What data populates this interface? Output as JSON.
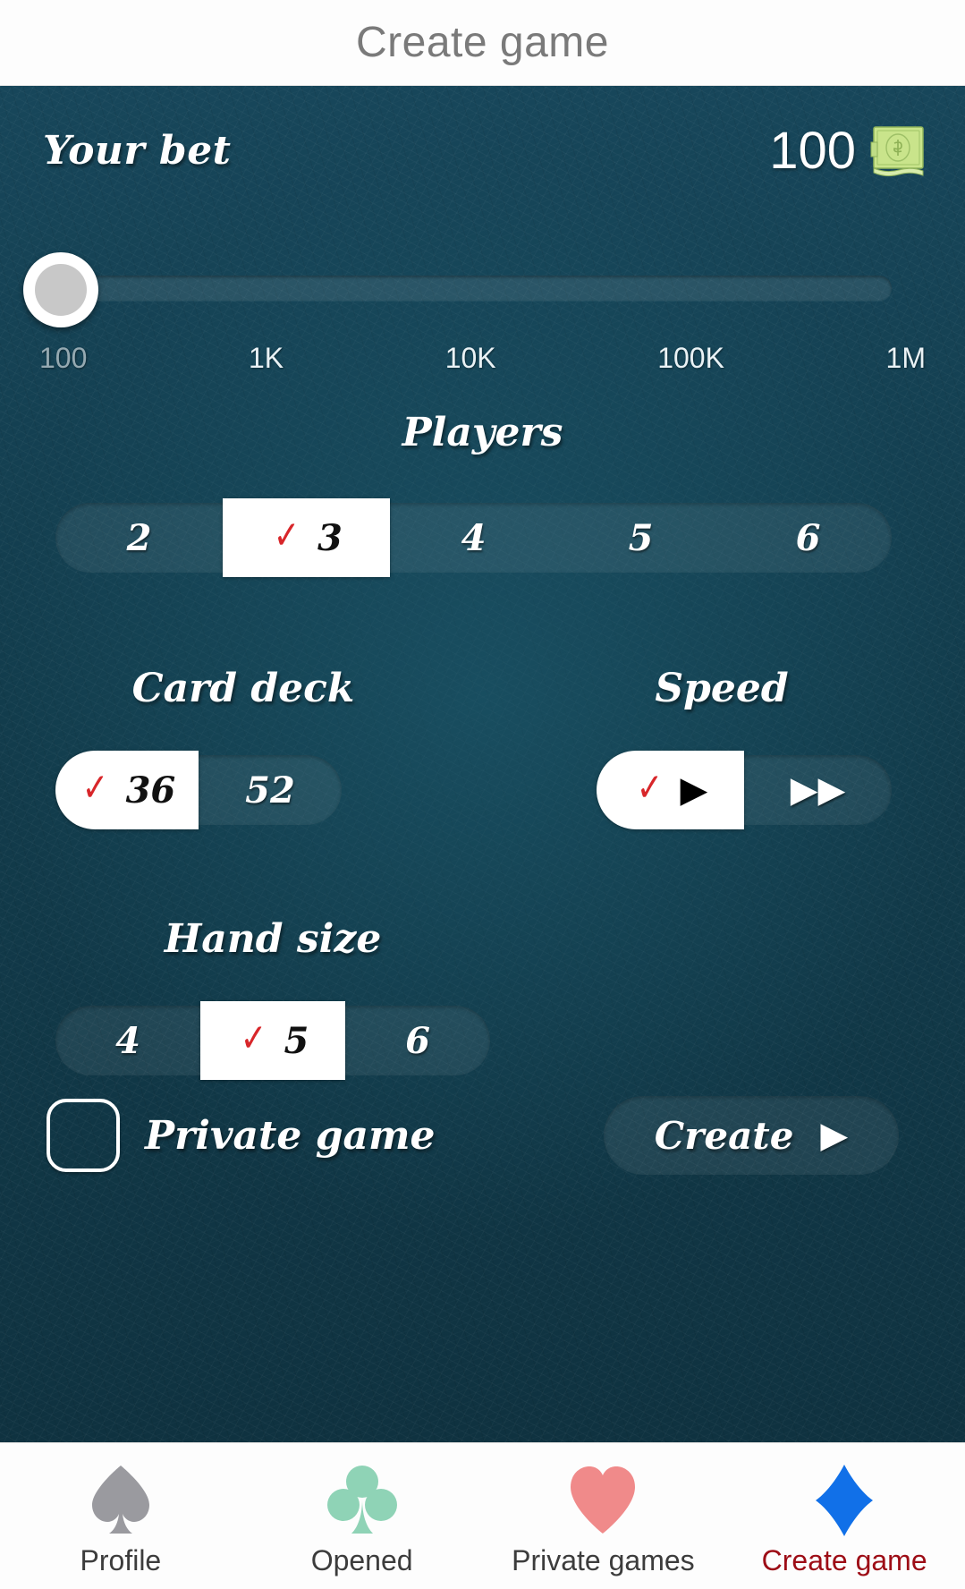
{
  "header": {
    "title": "Create game"
  },
  "bet": {
    "label": "Your bet",
    "amount": "100",
    "money_icon": "banknote-icon",
    "slider": {
      "value": "100",
      "min": "100",
      "max": "1M",
      "thumb_position_percent": 0,
      "ticks": [
        "100",
        "1K",
        "10K",
        "100K",
        "1M"
      ]
    }
  },
  "players": {
    "title": "Players",
    "selected": "3",
    "options": [
      {
        "label": "2",
        "selected": false
      },
      {
        "label": "3",
        "selected": true
      },
      {
        "label": "4",
        "selected": false
      },
      {
        "label": "5",
        "selected": false
      },
      {
        "label": "6",
        "selected": false
      }
    ]
  },
  "card_deck": {
    "title": "Card deck",
    "selected": "36",
    "options": [
      {
        "label": "36",
        "selected": true
      },
      {
        "label": "52",
        "selected": false
      }
    ]
  },
  "speed": {
    "title": "Speed",
    "selected": "normal",
    "options": [
      {
        "label": "▶",
        "icon": "play-icon",
        "selected": true
      },
      {
        "label": "▶▶",
        "icon": "fast-forward-icon",
        "selected": false
      }
    ]
  },
  "hand_size": {
    "title": "Hand size",
    "selected": "5",
    "options": [
      {
        "label": "4",
        "selected": false
      },
      {
        "label": "5",
        "selected": true
      },
      {
        "label": "6",
        "selected": false
      }
    ]
  },
  "private_game": {
    "label": "Private game",
    "checked": false
  },
  "create_button": {
    "label": "Create",
    "arrow": "▶"
  },
  "checkmark": "✓",
  "navbar": {
    "items": [
      {
        "label": "Profile",
        "icon": "spade-icon",
        "color": "#9a9a9f",
        "active": false
      },
      {
        "label": "Opened",
        "icon": "club-icon",
        "color": "#8fd3b6",
        "active": false
      },
      {
        "label": "Private games",
        "icon": "heart-icon",
        "color": "#f08a8a",
        "active": false
      },
      {
        "label": "Create game",
        "icon": "diamond-icon",
        "color": "#1170e8",
        "active": true
      }
    ]
  },
  "colors": {
    "felt": "#13404f",
    "accent_red": "#d8262a",
    "active_nav_text": "#9d0d16",
    "money_green": "#b9dc7c"
  }
}
